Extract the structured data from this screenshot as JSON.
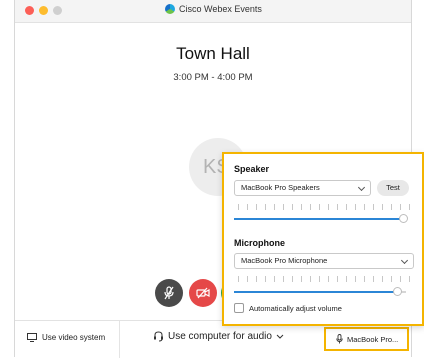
{
  "window": {
    "app_title": "Cisco Webex Events"
  },
  "meeting": {
    "title": "Town Hall",
    "time": "3:00 PM - 4:00 PM",
    "avatar_initials": "KS"
  },
  "bottom_bar": {
    "video_system_label": "Use video system",
    "audio_label": "Use computer for audio",
    "device_label": "MacBook Pro..."
  },
  "audio_popup": {
    "speaker_heading": "Speaker",
    "speaker_selected": "MacBook Pro Speakers",
    "test_label": "Test",
    "speaker_volume_fraction": 0.98,
    "microphone_heading": "Microphone",
    "microphone_selected": "MacBook Pro Microphone",
    "microphone_volume_fraction": 0.95,
    "auto_adjust_label": "Automatically adjust volume",
    "auto_adjust_checked": false
  },
  "colors": {
    "highlight": "#f4b400",
    "slider": "#2b86d6",
    "mute_button": "#4a4a4a",
    "video_button": "#e54848",
    "join_button": "#2fa84f"
  }
}
